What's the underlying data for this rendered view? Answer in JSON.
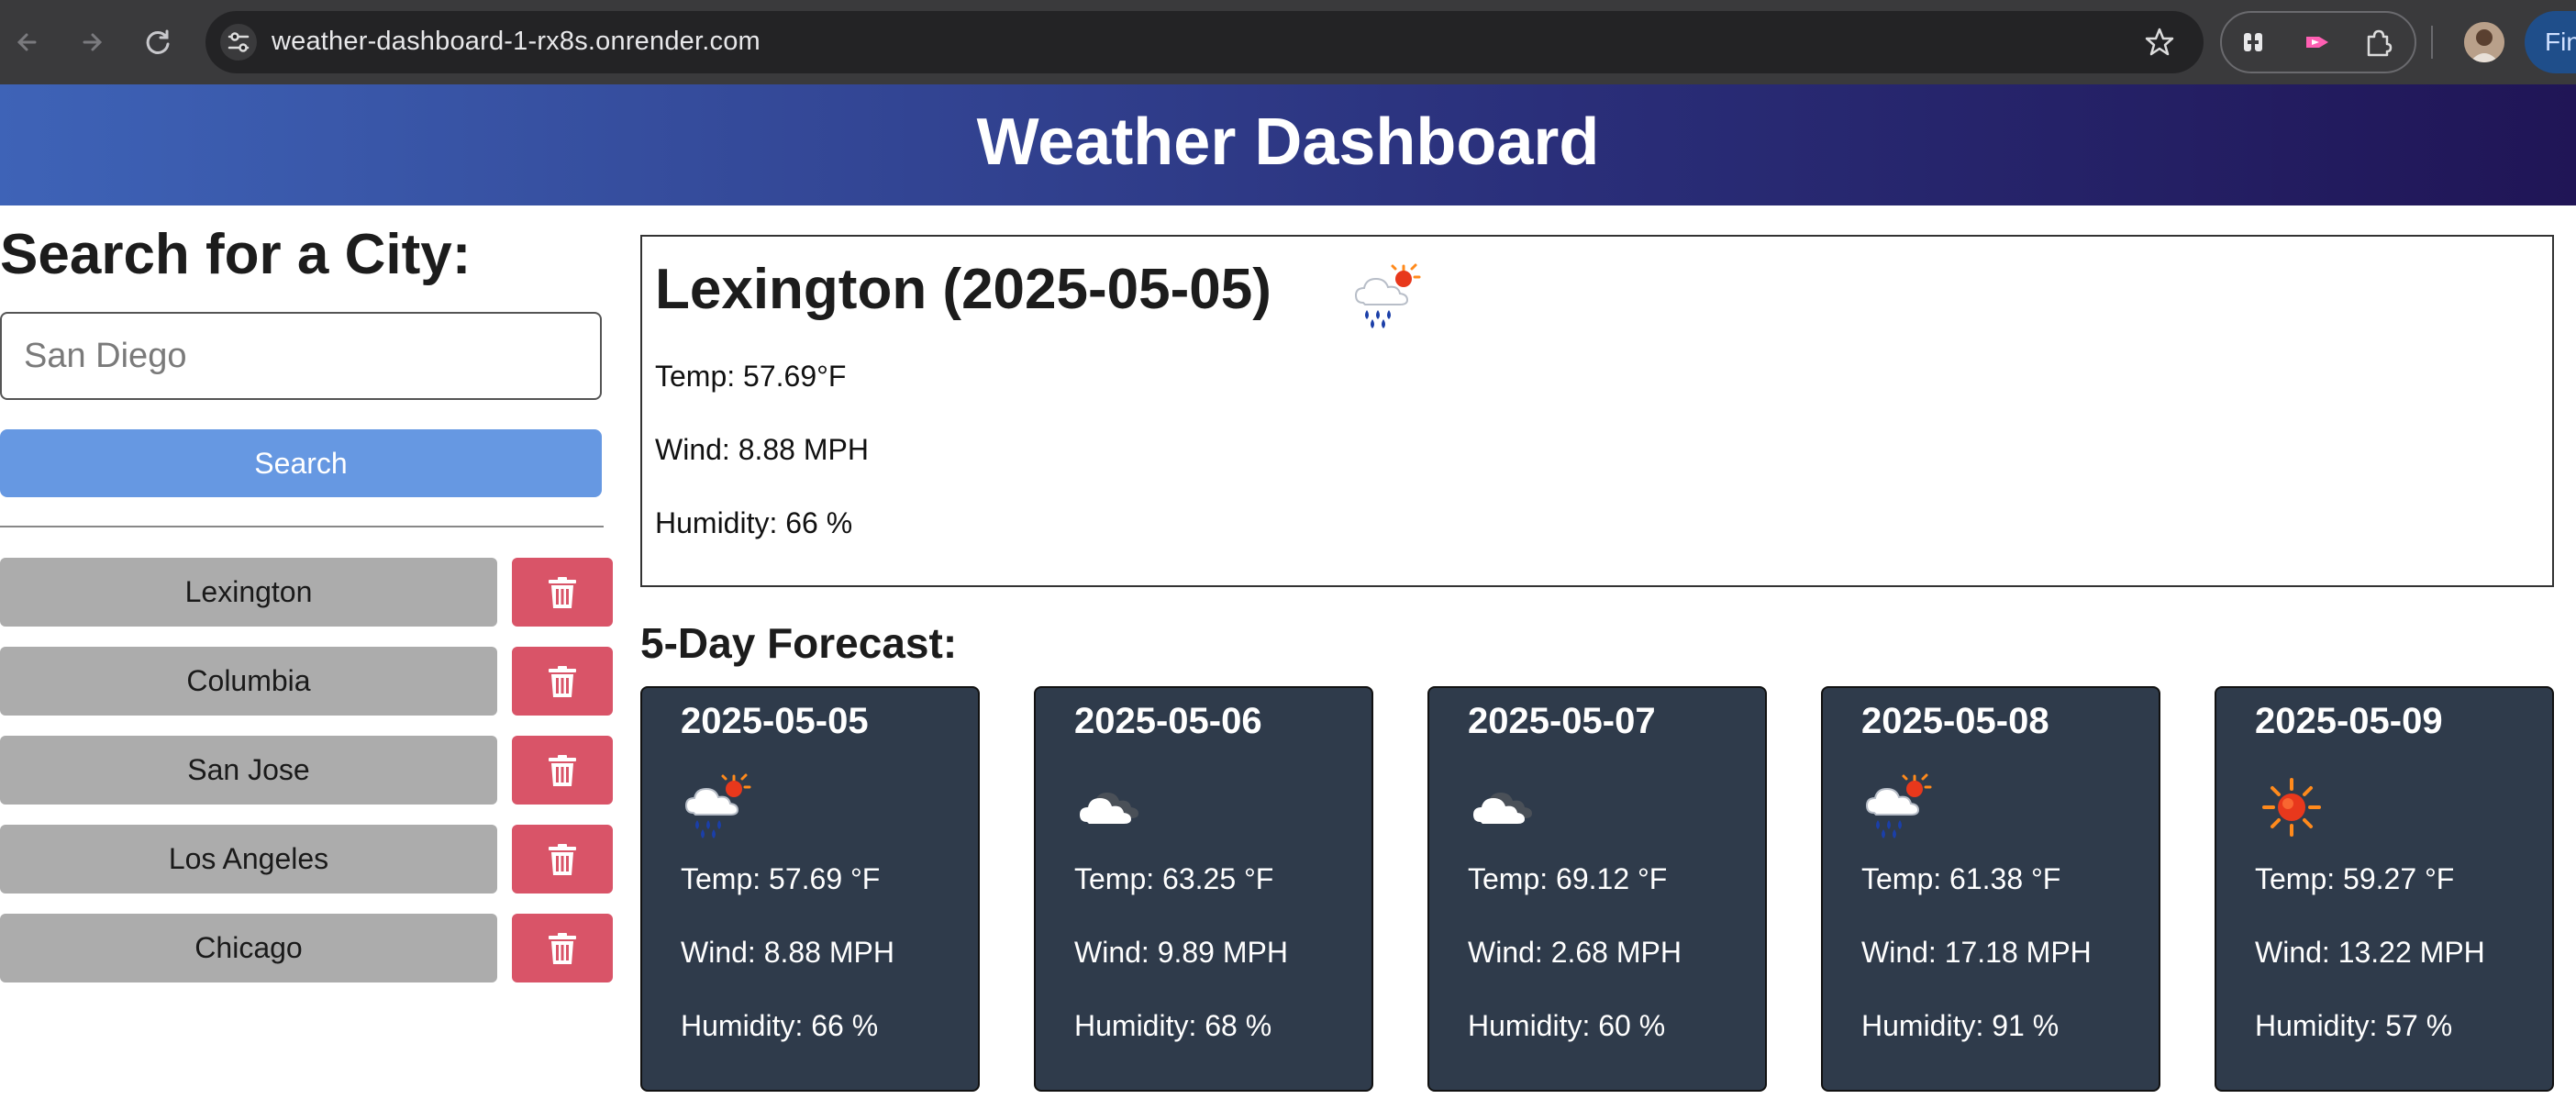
{
  "browser": {
    "url": "weather-dashboard-1-rx8s.onrender.com",
    "profile_label": "Fin"
  },
  "header": {
    "title": "Weather Dashboard"
  },
  "sidebar": {
    "title": "Search for a City:",
    "search_placeholder": "San Diego",
    "search_button": "Search",
    "history": [
      {
        "city": "Lexington"
      },
      {
        "city": "Columbia"
      },
      {
        "city": "San Jose"
      },
      {
        "city": "Los Angeles"
      },
      {
        "city": "Chicago"
      }
    ]
  },
  "today": {
    "title": "Lexington (2025-05-05)",
    "icon": "rain-sun-icon",
    "temp": "Temp: 57.69°F",
    "wind": "Wind: 8.88 MPH",
    "humidity": "Humidity: 66 %"
  },
  "forecast": {
    "title": "5-Day Forecast:",
    "days": [
      {
        "date": "2025-05-05",
        "icon": "rain-sun-icon",
        "temp": "Temp: 57.69 °F",
        "wind": "Wind: 8.88 MPH",
        "humidity": "Humidity: 66 %"
      },
      {
        "date": "2025-05-06",
        "icon": "cloud-icon",
        "temp": "Temp: 63.25 °F",
        "wind": "Wind: 9.89 MPH",
        "humidity": "Humidity: 68 %"
      },
      {
        "date": "2025-05-07",
        "icon": "cloud-icon",
        "temp": "Temp: 69.12 °F",
        "wind": "Wind: 2.68 MPH",
        "humidity": "Humidity: 60 %"
      },
      {
        "date": "2025-05-08",
        "icon": "rain-sun-icon",
        "temp": "Temp: 61.38 °F",
        "wind": "Wind: 17.18 MPH",
        "humidity": "Humidity: 91 %"
      },
      {
        "date": "2025-05-09",
        "icon": "sun-icon",
        "temp": "Temp: 59.27 °F",
        "wind": "Wind: 13.22 MPH",
        "humidity": "Humidity: 57 %"
      }
    ]
  },
  "colors": {
    "search_button": "#6698e2",
    "delete_button": "#d95468",
    "history_button": "#acacac",
    "forecast_card": "#2f3b4b"
  }
}
